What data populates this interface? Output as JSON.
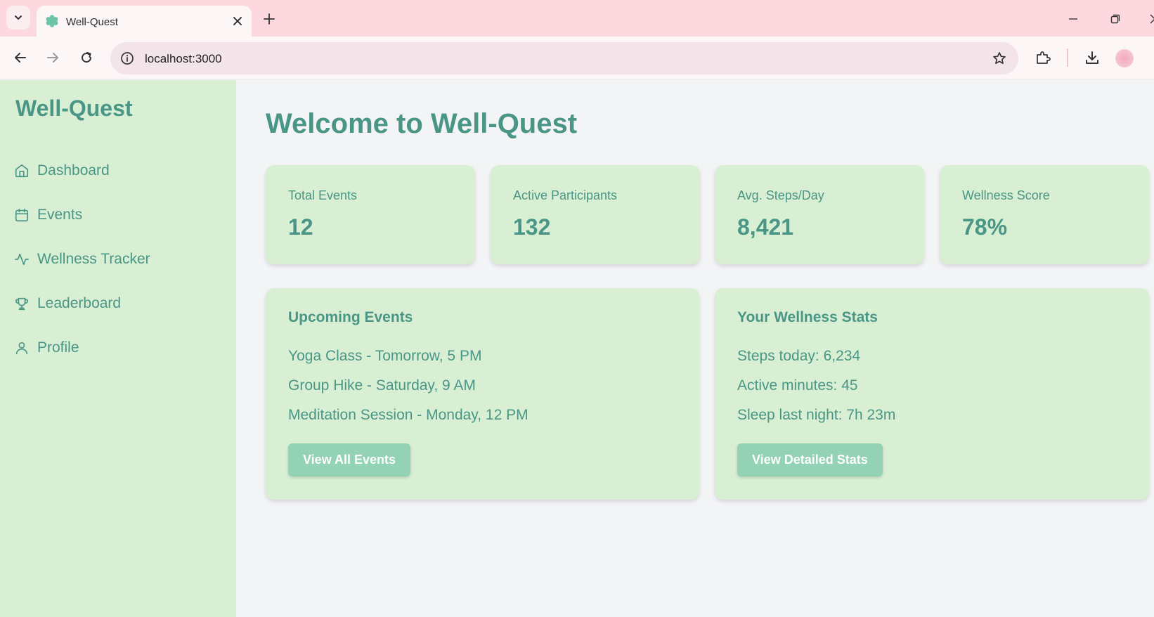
{
  "browser": {
    "tab_title": "Well-Quest",
    "url": "localhost:3000"
  },
  "sidebar": {
    "brand": "Well-Quest",
    "items": [
      {
        "label": "Dashboard",
        "icon": "home-icon"
      },
      {
        "label": "Events",
        "icon": "calendar-icon"
      },
      {
        "label": "Wellness Tracker",
        "icon": "activity-icon"
      },
      {
        "label": "Leaderboard",
        "icon": "trophy-icon"
      },
      {
        "label": "Profile",
        "icon": "user-icon"
      }
    ]
  },
  "main": {
    "title": "Welcome to Well-Quest",
    "stats": [
      {
        "label": "Total Events",
        "value": "12"
      },
      {
        "label": "Active Participants",
        "value": "132"
      },
      {
        "label": "Avg. Steps/Day",
        "value": "8,421"
      },
      {
        "label": "Wellness Score",
        "value": "78%"
      }
    ],
    "upcoming": {
      "title": "Upcoming Events",
      "items": [
        "Yoga Class - Tomorrow, 5 PM",
        "Group Hike - Saturday, 9 AM",
        "Meditation Session - Monday, 12 PM"
      ],
      "button": "View All Events"
    },
    "wellness": {
      "title": "Your Wellness Stats",
      "items": [
        "Steps today: 6,234",
        "Active minutes: 45",
        "Sleep last night: 7h 23m"
      ],
      "button": "View Detailed Stats"
    }
  },
  "colors": {
    "accent": "#4a9686",
    "card_bg": "#d8efd4",
    "button_bg": "#93d2b5",
    "page_bg": "#f3f4f6",
    "tabbar_bg": "#fdd9df"
  }
}
